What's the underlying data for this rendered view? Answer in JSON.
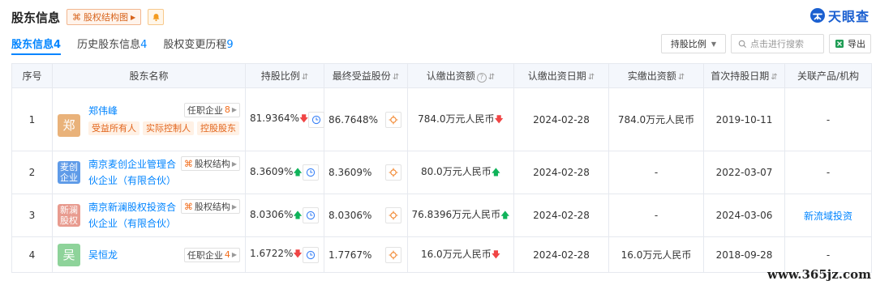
{
  "header": {
    "title": "股东信息",
    "struct_tag": "股权结构图",
    "brand": "天眼查"
  },
  "tabs": [
    {
      "label": "股东信息",
      "count": "4"
    },
    {
      "label": "历史股东信息",
      "count": "4"
    },
    {
      "label": "股权变更历程",
      "count": "9"
    }
  ],
  "toolbar": {
    "sort_select": "持股比例",
    "search_placeholder": "点击进行搜索",
    "export_label": "导出"
  },
  "table": {
    "headers": [
      "序号",
      "股东名称",
      "持股比例",
      "最终受益股份",
      "认缴出资额",
      "认缴出资日期",
      "实缴出资额",
      "首次持股日期",
      "关联产品/机构"
    ],
    "rows": [
      {
        "no": "1",
        "avatar": "郑",
        "avatar_color": "#e9b27a",
        "name_line1": "郑伟峰",
        "name_line2": "",
        "pill_label": "任职企业",
        "pill_count": "8",
        "labels": [
          "受益所有人",
          "实际控制人",
          "控股股东"
        ],
        "ratio": "81.9364%",
        "ratio_trend": "down",
        "final_share": "86.7648%",
        "subscribed": "784.0万元人民币",
        "subscribed_trend": "down",
        "sub_date": "2024-02-28",
        "paid": "784.0万元人民币",
        "first_date": "2019-10-11",
        "related": "-"
      },
      {
        "no": "2",
        "avatar": "麦创企业",
        "avatar_color": "#5f9be8",
        "name_line1": "南京麦创企业管理合",
        "name_line2": "伙企业（有限合伙）",
        "pill_label": "股权结构",
        "pill_count": "",
        "labels": [],
        "ratio": "8.3609%",
        "ratio_trend": "up",
        "final_share": "8.3609%",
        "subscribed": "80.0万元人民币",
        "subscribed_trend": "up",
        "sub_date": "2024-02-28",
        "paid": "-",
        "first_date": "2022-03-07",
        "related": "-"
      },
      {
        "no": "3",
        "avatar": "新澜股权",
        "avatar_color": "#e89b8f",
        "name_line1": "南京新澜股权投资合",
        "name_line2": "伙企业（有限合伙）",
        "pill_label": "股权结构",
        "pill_count": "",
        "labels": [],
        "ratio": "8.0306%",
        "ratio_trend": "up",
        "final_share": "8.0306%",
        "subscribed": "76.8396万元人民币",
        "subscribed_trend": "up",
        "sub_date": "2024-02-28",
        "paid": "-",
        "first_date": "2024-03-06",
        "related": "新流域投资"
      },
      {
        "no": "4",
        "avatar": "吴",
        "avatar_color": "#8ed39a",
        "name_line1": "吴恒龙",
        "name_line2": "",
        "pill_label": "任职企业",
        "pill_count": "4",
        "labels": [],
        "ratio": "1.6722%",
        "ratio_trend": "down",
        "final_share": "1.7767%",
        "subscribed": "16.0万元人民币",
        "subscribed_trend": "down",
        "sub_date": "2024-02-28",
        "paid": "16.0万元人民币",
        "first_date": "2018-09-28",
        "related": "-"
      }
    ]
  },
  "watermark": "www.365jz.com",
  "colors": {
    "accent": "#0084ff",
    "brand": "#1a5fd0",
    "tag_orange": "#e2651c",
    "up": "#10b35a",
    "down": "#f04545"
  }
}
